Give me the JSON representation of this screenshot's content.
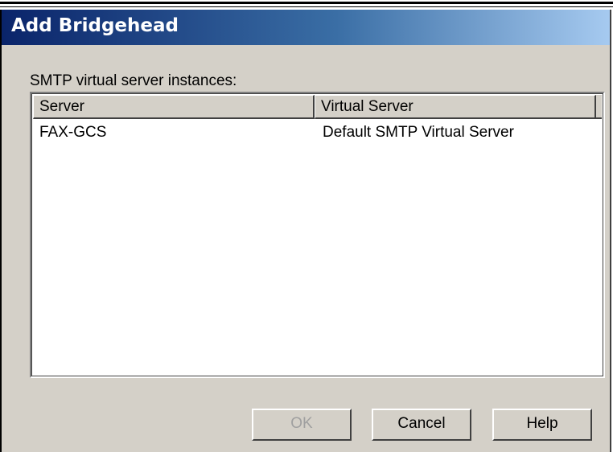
{
  "window": {
    "title": "Add Bridgehead"
  },
  "list": {
    "label": "SMTP virtual server instances:",
    "columns": [
      "Server",
      "Virtual Server"
    ],
    "rows": [
      {
        "server": "FAX-GCS",
        "virtual_server": "Default SMTP Virtual Server"
      }
    ]
  },
  "buttons": {
    "ok": "OK",
    "cancel": "Cancel",
    "help": "Help"
  },
  "state": {
    "ok_enabled": false
  }
}
